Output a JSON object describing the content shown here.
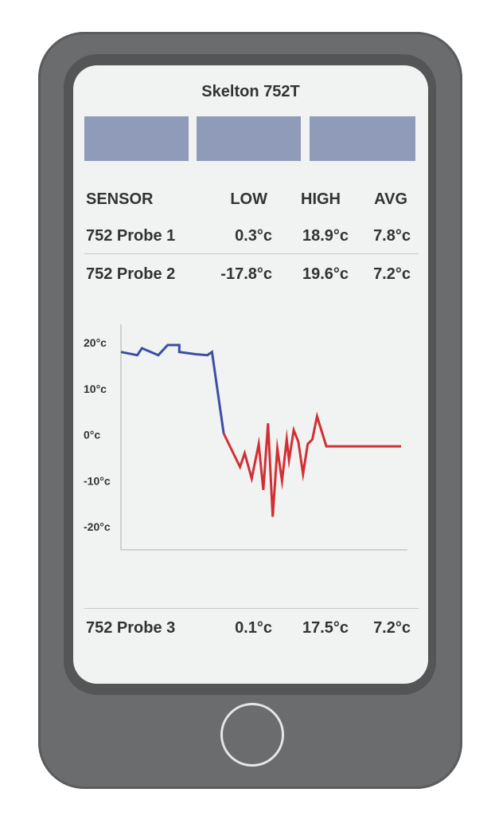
{
  "app": {
    "title": "Skelton 752T"
  },
  "tabs": [
    {
      "label": ""
    },
    {
      "label": ""
    },
    {
      "label": ""
    }
  ],
  "table": {
    "headers": {
      "sensor": "SENSOR",
      "low": "LOW",
      "high": "HIGH",
      "avg": "AVG"
    },
    "rows": [
      {
        "sensor": "752 Probe 1",
        "low": "0.3°c",
        "high": "18.9°c",
        "avg": "7.8°c"
      },
      {
        "sensor": "752 Probe 2",
        "low": "-17.8°c",
        "high": "19.6°c",
        "avg": "7.2°c"
      },
      {
        "sensor": "752 Probe 3",
        "low": "0.1°c",
        "high": "17.5°c",
        "avg": "7.2°c"
      }
    ]
  },
  "colors": {
    "tab": "#8f9bb8",
    "line_above_zero": "#3b4ea5",
    "line_below_zero": "#d22f33"
  },
  "chart_data": {
    "type": "line",
    "title": "",
    "xlabel": "",
    "ylabel": "",
    "yticks": [
      "20°c",
      "10°c",
      "0°c",
      "-10°c",
      "-20°c"
    ],
    "ytick_values": [
      20,
      10,
      0,
      -10,
      -20
    ],
    "ylim": [
      -25,
      24
    ],
    "xlim": [
      0,
      60
    ],
    "grid": false,
    "series": [
      {
        "color": "#3b4ea5",
        "x": [
          0,
          3.5,
          4.5,
          8,
          10,
          12.5,
          12.5,
          16,
          18.5,
          19.5,
          22
        ],
        "y": [
          18,
          17.3,
          18.8,
          17.3,
          19.5,
          19.5,
          18,
          17.5,
          17.3,
          18,
          0.3
        ]
      },
      {
        "color": "#d22f33",
        "x": [
          22,
          25.5,
          26.5,
          28,
          29.5,
          30.5,
          31.5,
          32.5,
          33.5,
          34.5,
          35.5,
          36,
          37,
          38,
          39,
          40,
          41,
          42,
          44,
          60
        ],
        "y": [
          0.3,
          -7,
          -4,
          -9.5,
          -2,
          -12,
          2.5,
          -17.8,
          -3,
          -10,
          -1,
          -5.5,
          1,
          -1.5,
          -8.5,
          -2,
          -1,
          4,
          -2.5,
          -2.5
        ]
      }
    ]
  }
}
